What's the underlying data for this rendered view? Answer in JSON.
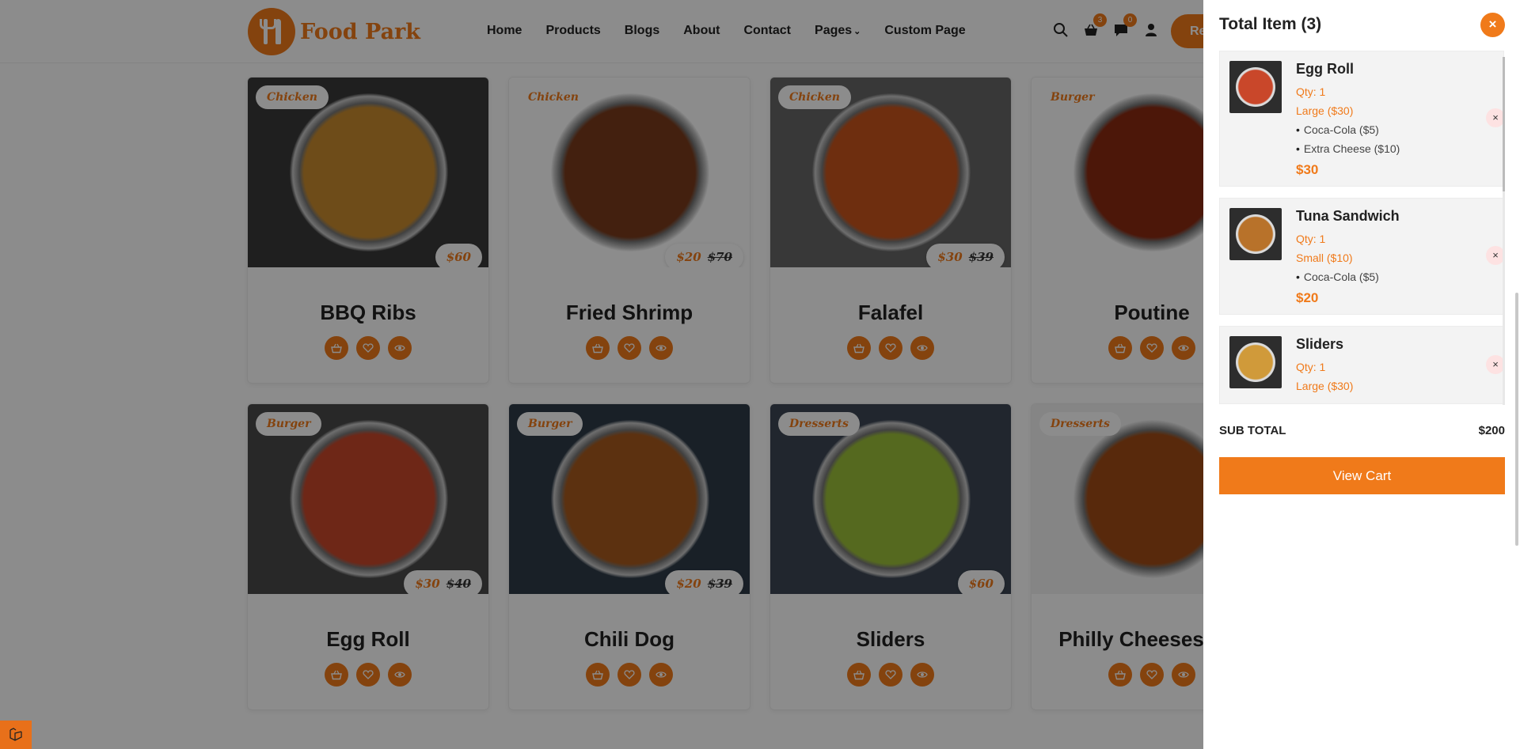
{
  "header": {
    "logo_text": "Food Park",
    "nav": [
      "Home",
      "Products",
      "Blogs",
      "About",
      "Contact",
      "Pages",
      "Custom Page"
    ],
    "cart_count": "3",
    "message_count": "0",
    "reserve_label": "Reservation"
  },
  "products": [
    {
      "name": "BBQ Ribs",
      "category": "Chicken",
      "price": "$60",
      "old_price": "",
      "color": "#c98b2e"
    },
    {
      "name": "Fried Shrimp",
      "category": "Chicken",
      "price": "$20",
      "old_price": "$70",
      "color": "#7a3b1c"
    },
    {
      "name": "Falafel",
      "category": "Chicken",
      "price": "$30",
      "old_price": "$39",
      "color": "#c8541c"
    },
    {
      "name": "Poutine",
      "category": "Burger",
      "price": "",
      "old_price": "",
      "color": "#8a2a12"
    },
    {
      "name": "Egg Roll",
      "category": "Burger",
      "price": "$30",
      "old_price": "$40",
      "color": "#c9472a"
    },
    {
      "name": "Chili Dog",
      "category": "Burger",
      "price": "$20",
      "old_price": "$39",
      "color": "#a85a1e"
    },
    {
      "name": "Sliders",
      "category": "Dresserts",
      "price": "$60",
      "old_price": "",
      "color": "#9cbf3a"
    },
    {
      "name": "Philly Cheesesteak",
      "category": "Dresserts",
      "price": "",
      "old_price": "",
      "color": "#a04c16"
    }
  ],
  "cart": {
    "title": "Total Item (3)",
    "close_symbol": "×",
    "items": [
      {
        "name": "Egg Roll",
        "qty": "Qty: 1",
        "size": "Large ($30)",
        "addons": [
          "Coca-Cola ($5)",
          "Extra Cheese ($10)"
        ],
        "price": "$30",
        "color": "#c9472a"
      },
      {
        "name": "Tuna Sandwich",
        "qty": "Qty: 1",
        "size": "Small ($10)",
        "addons": [
          "Coca-Cola ($5)"
        ],
        "price": "$20",
        "color": "#b8722a"
      },
      {
        "name": "Sliders",
        "qty": "Qty: 1",
        "size": "Large ($30)",
        "addons": [],
        "price": "",
        "color": "#d09a3a"
      }
    ],
    "remove_symbol": "×",
    "subtotal_label": "SUB TOTAL",
    "subtotal_value": "$200",
    "view_cart_label": "View Cart"
  },
  "colors": {
    "accent": "#f07a1a"
  }
}
